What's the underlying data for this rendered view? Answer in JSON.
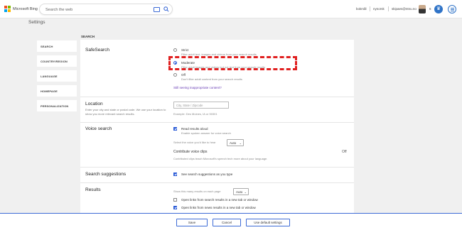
{
  "header": {
    "logo_text": "Microsoft Bing",
    "search_placeholder": "Search the web",
    "language_link": "bokmål",
    "region_link": "nynorsk",
    "user_email": "skipaes@ntnu.no",
    "rewards_count": "6",
    "rewards_icon": "trophy-icon",
    "logo_colors": [
      "#f25022",
      "#7fba00",
      "#00a4ef",
      "#ffb900"
    ],
    "accent_color": "#3d6bd6"
  },
  "page": {
    "title": "Settings",
    "section_label": "SEARCH"
  },
  "sidebar": {
    "items": [
      {
        "label": "SEARCH"
      },
      {
        "label": "COUNTRY/REGION"
      },
      {
        "label": "LANGUAGE"
      },
      {
        "label": "HOMEPAGE"
      },
      {
        "label": "PERSONALIZATION"
      }
    ]
  },
  "safesearch": {
    "title": "SafeSearch",
    "selected": "Moderate",
    "options": [
      {
        "label": "Strict",
        "desc": "Filter adult text, images and videos from your search results"
      },
      {
        "label": "Moderate",
        "desc": "Filter adult images and videos but not text from your search results"
      },
      {
        "label": "Off",
        "desc": "Don't filter adult content from your search results"
      }
    ],
    "link": "Still seeing inappropriate content?"
  },
  "location": {
    "title": "Location",
    "desc": "Enter your city and state or postal code. We use your location to show you more relevant search results.",
    "placeholder": "City, State / Zipcode",
    "example": "Example: Des Moines, IA or 50301"
  },
  "voice": {
    "title": "Voice search",
    "read_aloud_label": "Read results aloud",
    "read_aloud_checked": true,
    "read_aloud_desc": "Enable spoken answer for voice search",
    "voice_label": "Select the voice you'd like to hear",
    "voice_value": "Auto",
    "clips_title": "Contribute voice clips",
    "clips_desc": "Contributed clips teach Microsoft's speech tech more about your language.",
    "clips_state": "Off"
  },
  "suggestions": {
    "title": "Search suggestions",
    "label": "See search suggestions as you type",
    "checked": true
  },
  "results": {
    "title": "Results",
    "per_page_label": "Show this many results on each page",
    "per_page_value": "Auto",
    "open_search_label": "Open links from search results in a new tab or window",
    "open_search_checked": false,
    "open_news_label": "Open links from news results in a new tab or window",
    "open_news_checked": true
  },
  "footer": {
    "save_label": "Save",
    "cancel_label": "Cancel",
    "default_label": "Use default settings"
  }
}
